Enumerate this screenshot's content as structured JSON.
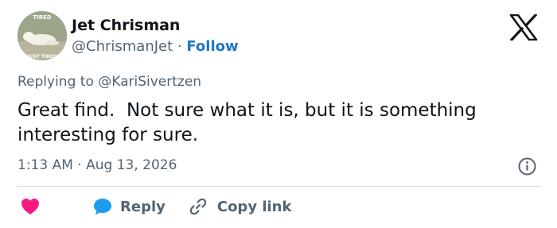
{
  "author": {
    "name": "Jet Chrisman",
    "handle": "@ChrismanJet",
    "separator": " · ",
    "follow_label": "Follow",
    "avatar_text_top": "TIRED",
    "avatar_text_bottom": "JUST TIRED"
  },
  "reply_prefix": "Replying to ",
  "reply_to": "@KariSivertzen",
  "tweet_text": "Great find.  Not sure what it is, but it is something interesting for sure.",
  "timestamp": "1:13 AM · Aug 13, 2026",
  "actions": {
    "reply_label": "Reply",
    "copy_link_label": "Copy link"
  },
  "colors": {
    "heart": "#f91880",
    "reply_bubble": "#1d9bf0",
    "follow": "#1d77c7",
    "secondary_text": "#536471"
  },
  "icons": [
    "x-logo-icon",
    "info-icon",
    "heart-icon",
    "reply-bubble-icon",
    "link-icon"
  ]
}
